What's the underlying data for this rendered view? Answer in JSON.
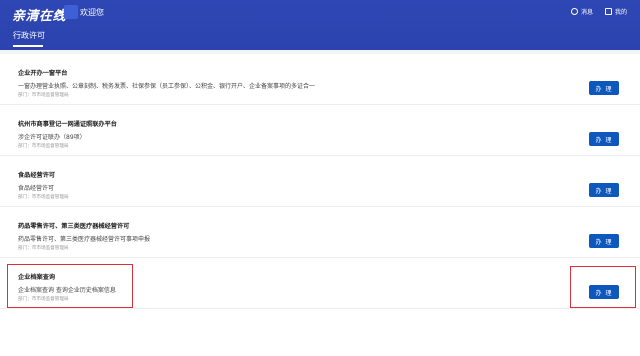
{
  "header": {
    "logo": "亲清在线",
    "welcome": "欢迎您",
    "messages_label": "消息",
    "mine_label": "我的",
    "tab": "行政许可"
  },
  "items": [
    {
      "title": "企业开办一窗平台",
      "desc": "一窗办理营业执照、公章刻制、税务发票、社保参保（员工参保）、公积金、银行开户、企业备案事项的多证合一",
      "dept": "部门：市市场监督管理局",
      "button": "办 理"
    },
    {
      "title": "杭州市商事登记一网通证照联办平台",
      "desc": "涉企许可证联办（89项）",
      "dept": "部门：市市场监督管理局",
      "button": "办 理"
    },
    {
      "title": "食品经营许可",
      "desc": "食品经营许可",
      "dept": "部门：市市场监督管理局",
      "button": "办 理"
    },
    {
      "title": "药品零售许可、第三类医疗器械经营许可",
      "desc": "药品零售许可、第三类医疗器械经营许可事项申报",
      "dept": "部门：市市场监督管理局",
      "button": "办 理"
    },
    {
      "title": "企业档案查询",
      "desc": "企业档案查询 查询企业历史档案信息",
      "dept": "部门：市市场监督管理局",
      "button": "办 理"
    }
  ],
  "colors": {
    "header_bg": "#2f47b4",
    "button_bg": "#0e58bd",
    "highlight": "#d6323a"
  }
}
